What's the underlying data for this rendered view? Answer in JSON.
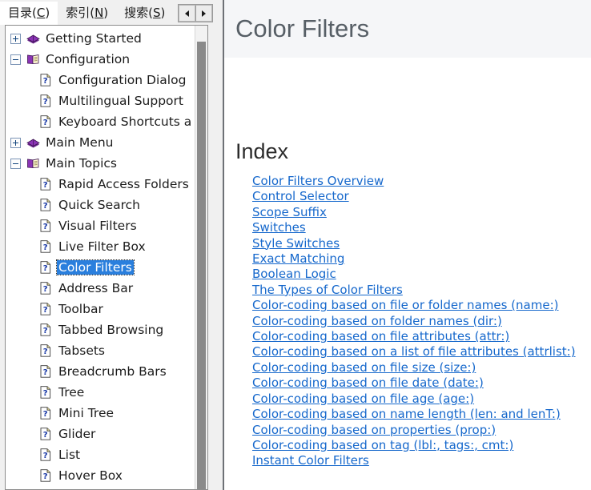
{
  "tabs": [
    {
      "name": "tab-contents",
      "label_pre": "目录(",
      "label_key": "C",
      "label_post": ")",
      "selected": true
    },
    {
      "name": "tab-index",
      "label_pre": "索引(",
      "label_key": "N",
      "label_post": ")",
      "selected": false
    },
    {
      "name": "tab-search",
      "label_pre": "搜索(",
      "label_key": "S",
      "label_post": ")",
      "selected": false
    }
  ],
  "tab_nav": {
    "back_label": "◀",
    "forward_label": "▶"
  },
  "tree": {
    "items": [
      {
        "label": "Getting Started",
        "level": 0,
        "icon": "closed-book-icon",
        "expander": "plus",
        "selected": false
      },
      {
        "label": "Configuration",
        "level": 0,
        "icon": "open-book-icon",
        "expander": "minus",
        "selected": false
      },
      {
        "label": "Configuration Dialog",
        "level": 1,
        "icon": "help-page-icon",
        "expander": "none",
        "selected": false
      },
      {
        "label": "Multilingual Support",
        "level": 1,
        "icon": "help-page-icon",
        "expander": "none",
        "selected": false
      },
      {
        "label": "Keyboard Shortcuts a",
        "level": 1,
        "icon": "help-page-icon",
        "expander": "none",
        "selected": false
      },
      {
        "label": "Main Menu",
        "level": 0,
        "icon": "closed-book-icon",
        "expander": "plus",
        "selected": false
      },
      {
        "label": "Main Topics",
        "level": 0,
        "icon": "open-book-icon",
        "expander": "minus",
        "selected": false
      },
      {
        "label": "Rapid Access Folders",
        "level": 1,
        "icon": "help-page-icon",
        "expander": "none",
        "selected": false
      },
      {
        "label": "Quick Search",
        "level": 1,
        "icon": "help-page-icon",
        "expander": "none",
        "selected": false
      },
      {
        "label": "Visual Filters",
        "level": 1,
        "icon": "help-page-icon",
        "expander": "none",
        "selected": false
      },
      {
        "label": "Live Filter Box",
        "level": 1,
        "icon": "help-page-icon",
        "expander": "none",
        "selected": false
      },
      {
        "label": "Color Filters",
        "level": 1,
        "icon": "help-page-icon",
        "expander": "none",
        "selected": true
      },
      {
        "label": "Address Bar",
        "level": 1,
        "icon": "help-page-icon",
        "expander": "none",
        "selected": false
      },
      {
        "label": "Toolbar",
        "level": 1,
        "icon": "help-page-icon",
        "expander": "none",
        "selected": false
      },
      {
        "label": "Tabbed Browsing",
        "level": 1,
        "icon": "help-page-icon",
        "expander": "none",
        "selected": false
      },
      {
        "label": "Tabsets",
        "level": 1,
        "icon": "help-page-icon",
        "expander": "none",
        "selected": false
      },
      {
        "label": "Breadcrumb Bars",
        "level": 1,
        "icon": "help-page-icon",
        "expander": "none",
        "selected": false
      },
      {
        "label": "Tree",
        "level": 1,
        "icon": "help-page-icon",
        "expander": "none",
        "selected": false
      },
      {
        "label": "Mini Tree",
        "level": 1,
        "icon": "help-page-icon",
        "expander": "none",
        "selected": false
      },
      {
        "label": "Glider",
        "level": 1,
        "icon": "help-page-icon",
        "expander": "none",
        "selected": false
      },
      {
        "label": "List",
        "level": 1,
        "icon": "help-page-icon",
        "expander": "none",
        "selected": false
      },
      {
        "label": "Hover Box",
        "level": 1,
        "icon": "help-page-icon",
        "expander": "none",
        "selected": false
      }
    ]
  },
  "content": {
    "title": "Color Filters",
    "index_heading": "Index",
    "links": [
      "Color Filters Overview",
      "Control Selector",
      "Scope Suffix",
      "Switches",
      "Style Switches",
      "Exact Matching",
      "Boolean Logic",
      "The Types of Color Filters",
      "Color-coding based on file or folder names (name:)",
      "Color-coding based on folder names (dir:)",
      "Color-coding based on file attributes (attr:)",
      "Color-coding based on a list of file attributes (attrlist:)",
      "Color-coding based on file size (size:)",
      "Color-coding based on file date (date:)",
      "Color-coding based on file age (age:)",
      "Color-coding based on name length (len: and lenT:)",
      "Color-coding based on properties (prop:)",
      "Color-coding based on tag (lbl:, tags:, cmt:)",
      "Instant Color Filters"
    ]
  },
  "colors": {
    "link": "#1668cc",
    "selection": "#2a7fdd",
    "title": "#575f66",
    "header_bg": "#f5f6f8",
    "chrome_bg": "#f0f0f0"
  }
}
